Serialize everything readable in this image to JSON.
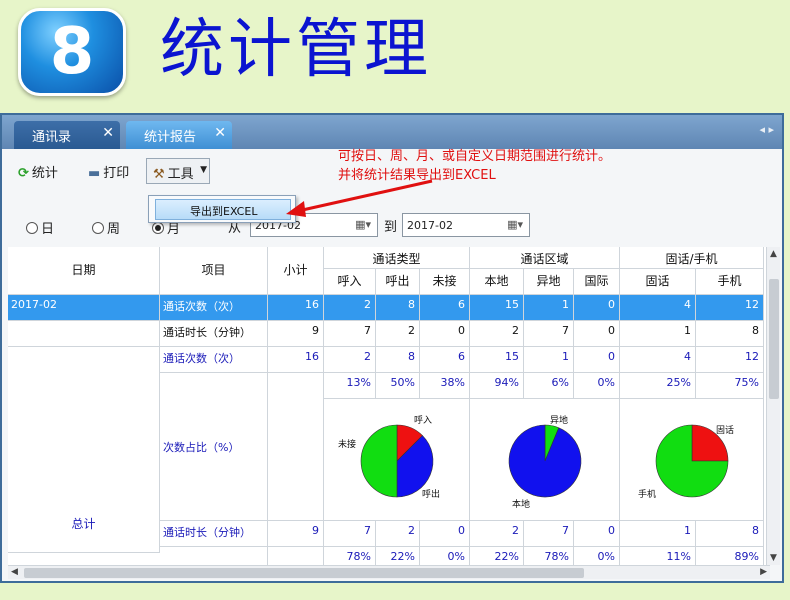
{
  "banner": {
    "number": "8",
    "title": "统计管理"
  },
  "tabs": [
    {
      "label": "通讯录",
      "close": "✕"
    },
    {
      "label": "统计报告",
      "close": "✕"
    }
  ],
  "tab_arrows": "◂ ▸",
  "toolbar": {
    "stat": "统计",
    "print": "打印",
    "tools": "工具"
  },
  "dropdown": {
    "export": "导出到EXCEL"
  },
  "annotation": {
    "line1": "可按日、周、月、或自定义日期范围进行统计。",
    "line2": "并将统计结果导出到EXCEL"
  },
  "filter": {
    "day": "日",
    "week": "周",
    "month": "月",
    "selected": "month",
    "from_label": "从",
    "to_label": "到",
    "from_value": "2017-02",
    "to_value": "2017-02"
  },
  "table": {
    "headers": {
      "date": "日期",
      "item": "项目",
      "subtotal": "小计",
      "group_type": "通话类型",
      "group_area": "通话区域",
      "group_phone": "固话/手机",
      "in": "呼入",
      "out": "呼出",
      "missed": "未接",
      "local": "本地",
      "remote": "异地",
      "intl": "国际",
      "fixed": "固话",
      "mobile": "手机"
    },
    "rows": [
      {
        "date": "2017-02",
        "item": "通话次数（次）",
        "subtotal": "16",
        "values": [
          "2",
          "8",
          "6",
          "15",
          "1",
          "0",
          "4",
          "12"
        ]
      },
      {
        "date": "",
        "item": "通话时长（分钟）",
        "subtotal": "9",
        "values": [
          "7",
          "2",
          "0",
          "2",
          "7",
          "0",
          "1",
          "8"
        ]
      }
    ],
    "total": {
      "label": "总计",
      "count_item": "通话次数（次）",
      "count_subtotal": "16",
      "count_values": [
        "2",
        "8",
        "6",
        "15",
        "1",
        "0",
        "4",
        "12"
      ],
      "count_pct": [
        "13%",
        "50%",
        "38%",
        "94%",
        "6%",
        "0%",
        "25%",
        "75%"
      ],
      "share_item": "次数占比（%）",
      "duration_item": "通话时长（分钟）",
      "duration_subtotal": "9",
      "duration_values": [
        "7",
        "2",
        "0",
        "2",
        "7",
        "0",
        "1",
        "8"
      ],
      "duration_pct": [
        "78%",
        "22%",
        "0%",
        "22%",
        "78%",
        "0%",
        "11%",
        "89%"
      ]
    },
    "pies": [
      {
        "labels": [
          "呼入",
          "未接",
          "呼出"
        ],
        "values": [
          2,
          6,
          8
        ],
        "colors": [
          "#ee1111",
          "#1111ee",
          "#11dd11"
        ]
      },
      {
        "labels": [
          "异地",
          "本地"
        ],
        "values": [
          1,
          15
        ],
        "colors": [
          "#11dd11",
          "#1111ee"
        ]
      },
      {
        "labels": [
          "固话",
          "手机"
        ],
        "values": [
          4,
          12
        ],
        "colors": [
          "#ee1111",
          "#11dd11"
        ]
      }
    ]
  },
  "colors": {
    "accent": "#3399ee",
    "title_blue": "#0b14d0",
    "annotation_red": "#e01010"
  }
}
